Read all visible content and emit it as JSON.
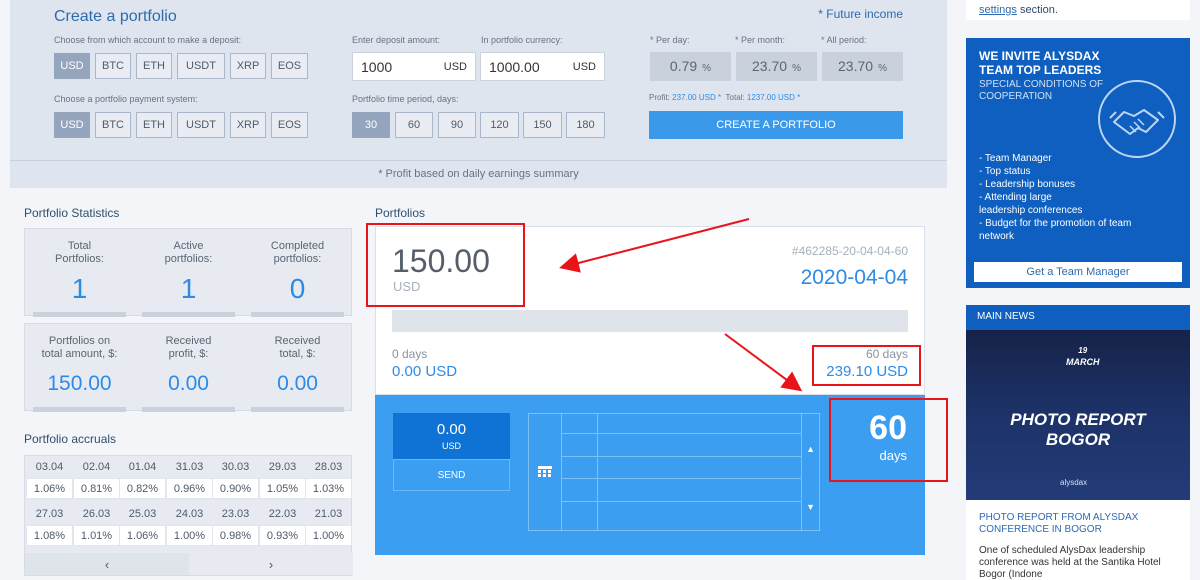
{
  "create": {
    "title": "Create a portfolio",
    "future_income": "* Future income",
    "deposit_account_label": "Choose from which account to make a deposit:",
    "payment_system_label": "Choose a portfolio payment system:",
    "currencies": [
      "USD",
      "BTC",
      "ETH",
      "USDT",
      "XRP",
      "EOS"
    ],
    "deposit_amount_label": "Enter deposit amount:",
    "deposit_amount_value": "1000",
    "deposit_amount_unit": "USD",
    "portfolio_currency_label": "In portfolio currency:",
    "portfolio_currency_value": "1000.00",
    "portfolio_currency_unit": "USD",
    "period_label": "Portfolio time period, days:",
    "periods": [
      "30",
      "60",
      "90",
      "120",
      "150",
      "180"
    ],
    "per_day_label": "* Per day:",
    "per_month_label": "* Per month:",
    "all_period_label": "* All period:",
    "per_day_value": "0.79",
    "per_month_value": "23.70",
    "all_period_value": "23.70",
    "percent_sign": "%",
    "profit_label": "Profit:",
    "profit_value": "237.00 USD *",
    "total_label": "Total:",
    "total_value": "1237.00 USD *",
    "create_button": "CREATE A PORTFOLIO",
    "footnote": "* Profit based on daily earnings summary"
  },
  "stats": {
    "title": "Portfolio Statistics",
    "row1": [
      {
        "label_1": "Total",
        "label_2": "Portfolios:",
        "value": "1"
      },
      {
        "label_1": "Active",
        "label_2": "portfolios:",
        "value": "1"
      },
      {
        "label_1": "Completed",
        "label_2": "portfolios:",
        "value": "0"
      }
    ],
    "row2": [
      {
        "label_1": "Portfolios on",
        "label_2": "total amount, $:",
        "value": "150.00"
      },
      {
        "label_1": "Received",
        "label_2": "profit, $:",
        "value": "0.00"
      },
      {
        "label_1": "Received",
        "label_2": "total, $:",
        "value": "0.00"
      }
    ]
  },
  "accruals": {
    "title": "Portfolio accruals",
    "row1_dates": [
      "03.04",
      "02.04",
      "01.04",
      "31.03",
      "30.03",
      "29.03",
      "28.03"
    ],
    "row1_values": [
      "1.06%",
      "0.81%",
      "0.82%",
      "0.96%",
      "0.90%",
      "1.05%",
      "1.03%"
    ],
    "row2_dates": [
      "27.03",
      "26.03",
      "25.03",
      "24.03",
      "23.03",
      "22.03",
      "21.03"
    ],
    "row2_values": [
      "1.08%",
      "1.01%",
      "1.06%",
      "1.00%",
      "0.98%",
      "0.93%",
      "1.00%"
    ],
    "prev_icon": "‹",
    "next_icon": "›"
  },
  "portfolios": {
    "title": "Portfolios",
    "amount": "150.00",
    "currency": "USD",
    "id": "#462285-20-04-04-60",
    "date": "2020-04-04",
    "start_days": "0 days",
    "start_amount": "0.00 USD",
    "end_days": "60 days",
    "end_amount": "239.10 USD",
    "progress": 0,
    "send_value": "0.00",
    "send_unit": "USD",
    "send_button": "SEND",
    "days_number": "60",
    "days_label": "days"
  },
  "sidebar": {
    "settings_link": "settings",
    "settings_suffix": " section.",
    "invite_title_1": "WE INVITE ALYSDAX",
    "invite_title_2": "TEAM TOP LEADERS",
    "invite_sub_1": "SPECIAL CONDITIONS OF",
    "invite_sub_2": "COOPERATION",
    "invite_items": [
      "- Team Manager",
      "- Top status",
      "- Leadership bonuses",
      "- Attending large",
      "leadership conferences",
      "- Budget for the promotion of team",
      "network"
    ],
    "invite_button": "Get a Team Manager",
    "news_head": "MAIN NEWS",
    "news_date_day": "19",
    "news_date_month": "MARCH",
    "news_photo_1": "PHOTO REPORT",
    "news_photo_2": "BOGOR",
    "news_brand": "alysdax",
    "news_title": "PHOTO REPORT FROM ALYSDAX CONFERENCE IN BOGOR",
    "news_text": "One of scheduled AlysDax leadership conference was held at the Santika Hotel Bogor (Indone"
  },
  "colors": {
    "accent": "#2d8be8",
    "chip_active": "#94a5bd",
    "blue_panel": "#3c9ef0",
    "sidebar_blue": "#0e5fbf",
    "annotation_red": "#e8141a"
  }
}
